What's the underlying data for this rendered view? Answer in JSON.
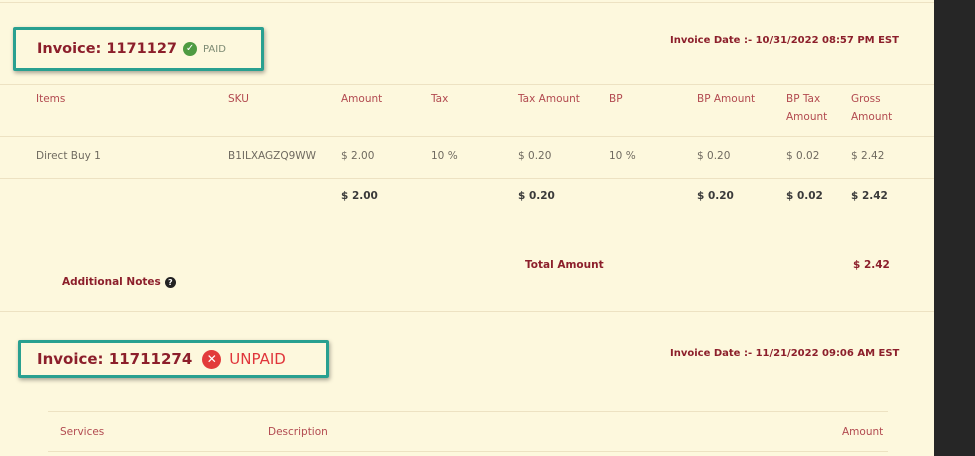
{
  "invoices": [
    {
      "title": "Invoice: 1171127",
      "status": "PAID",
      "date": "Invoice Date :- 10/31/2022 08:57 PM EST",
      "columns": [
        "Items",
        "SKU",
        "Amount",
        "Tax",
        "Tax Amount",
        "BP",
        "BP Amount",
        "BP Tax Amount",
        "Gross Amount"
      ],
      "rows": [
        [
          "Direct Buy 1",
          "B1ILXAGZQ9WW",
          "$ 2.00",
          "10 %",
          "$ 0.20",
          "10 %",
          "$ 0.20",
          "$ 0.02",
          "$ 2.42"
        ]
      ],
      "totals": {
        "amount": "$ 2.00",
        "tax_amount": "$ 0.20",
        "bp_amount": "$ 0.20",
        "bp_tax_amount": "$ 0.02",
        "gross_amount": "$ 2.42"
      },
      "total_amount_label": "Total Amount",
      "total_amount_value": "$ 2.42",
      "additional_notes": "Additional Notes"
    },
    {
      "title": "Invoice: 11711274",
      "status": "UNPAID",
      "date": "Invoice Date :- 11/21/2022 09:06 AM EST",
      "columns": [
        "Services",
        "Description",
        "Amount"
      ]
    }
  ],
  "icons": {
    "paid": "check-circle-icon",
    "unpaid": "x-circle-icon",
    "help": "question-circle-icon"
  },
  "colors": {
    "background": "#fdf8dd",
    "title": "#8c1f2b",
    "paid": "#4e9b42",
    "unpaid": "#e0353b",
    "highlight_box": "#29a090"
  }
}
